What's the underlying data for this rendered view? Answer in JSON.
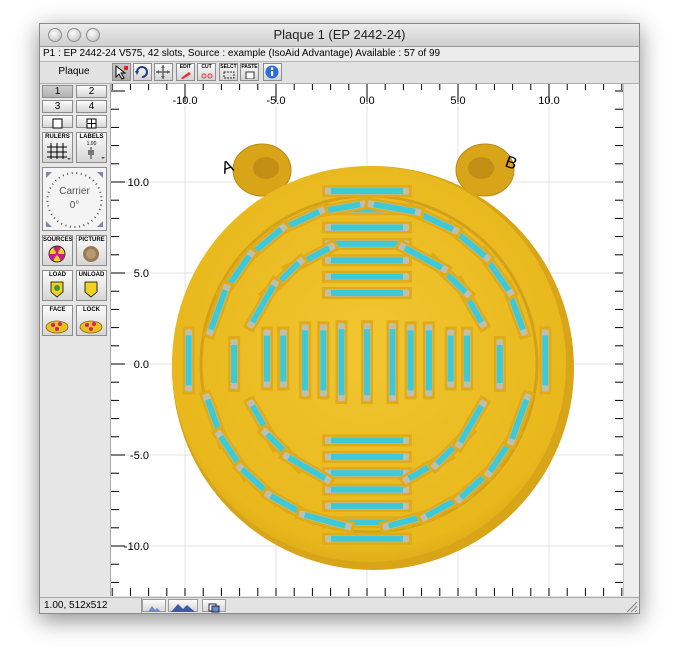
{
  "window": {
    "title": "Plaque 1 (EP 2442-24)",
    "info": "P1 : EP 2442-24 V575, 42 slots, Source : example (IsoAid Advantage) Available : 57 of 99"
  },
  "toolbar": {
    "plaque_label": "Plaque",
    "buttons": [
      {
        "name": "arrow-tool-icon",
        "label": ""
      },
      {
        "name": "rotate-tool-icon",
        "label": ""
      },
      {
        "name": "move-tool-icon",
        "label": ""
      },
      {
        "name": "edit-tool-icon",
        "label": "EDIT"
      },
      {
        "name": "cut-tool-icon",
        "label": "CUT"
      },
      {
        "name": "select-tool-icon",
        "label": "SELCT"
      },
      {
        "name": "paste-tool-icon",
        "label": "PASTE"
      },
      {
        "name": "info-icon",
        "label": ""
      }
    ]
  },
  "left_panel": {
    "view_buttons": [
      "1",
      "2",
      "3",
      "4"
    ],
    "rulers_label": "RULERS",
    "labels_label": "LABELS",
    "labels_value": "1.00",
    "carrier_label": "Carrier",
    "carrier_angle": "0°",
    "sources_label": "SOURCES",
    "picture_label": "PICTURE",
    "load_label": "LOAD",
    "unload_label": "UNLOAD",
    "face_label": "FACE",
    "lock_label": "LOCK"
  },
  "canvas": {
    "x_ticks": [
      "-10.0",
      "-5.0",
      "0.0",
      "5.0",
      "10.0"
    ],
    "y_ticks": [
      "10.0",
      "5.0",
      "0.0",
      "-5.0",
      "-10.0"
    ],
    "marker_a": "A",
    "marker_b": "B",
    "colors": {
      "gold": "#e8b81c",
      "gold_dark": "#c9941a",
      "seed_tube": "#bfbfb0",
      "seed_core": "#3ec9d6"
    }
  },
  "status": {
    "zoom": "1.00, 512x512"
  }
}
